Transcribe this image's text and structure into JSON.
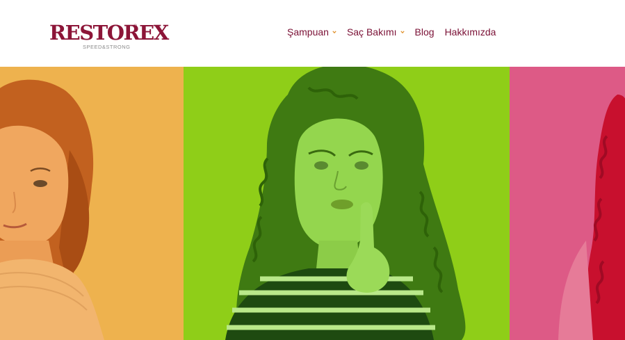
{
  "brand": {
    "name": "RESTOREX",
    "registered_mark": "®",
    "tagline": "SPEED&STRONG"
  },
  "nav": {
    "items": [
      {
        "label": "Şampuan",
        "has_dropdown": true
      },
      {
        "label": "Saç Bakımı",
        "has_dropdown": true
      },
      {
        "label": "Blog",
        "has_dropdown": false
      },
      {
        "label": "Hakkımızda",
        "has_dropdown": false
      }
    ]
  },
  "hero": {
    "panels": [
      {
        "name": "orange-panel",
        "color": "#eeb24e"
      },
      {
        "name": "green-panel",
        "color": "#8fce18"
      },
      {
        "name": "pink-panel",
        "color": "#dd5a86"
      }
    ]
  },
  "colors": {
    "brand": "#8c1538",
    "nav_text": "#7a1035",
    "dropdown_chevron": "#e0902a",
    "tagline": "#8a8a8a"
  },
  "icons": {
    "dropdown": "chevron-down-icon"
  }
}
